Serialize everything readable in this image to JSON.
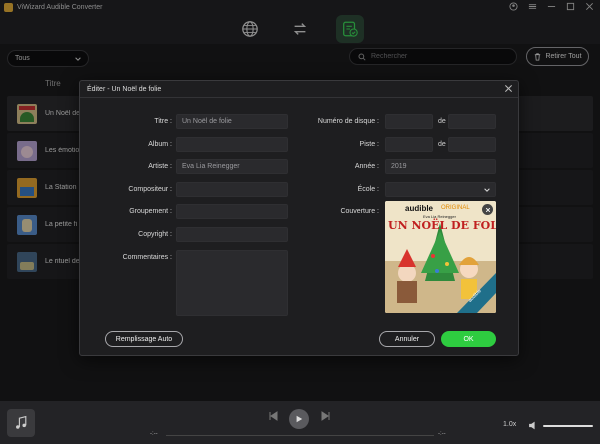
{
  "app": {
    "title": "ViWizard Audible Converter"
  },
  "toolbar": {
    "filter_selected": "Tous",
    "search_placeholder": "Rechercher",
    "remove_all_label": "Retirer Tout"
  },
  "list": {
    "column_title": "Titre",
    "items": [
      {
        "title": "Un Noël de folie"
      },
      {
        "title": "Les émotions"
      },
      {
        "title": "La Station"
      },
      {
        "title": "La petite fi"
      },
      {
        "title": "Le rituel de"
      }
    ]
  },
  "dialog": {
    "title": "Éditer - Un Noël de folie",
    "labels": {
      "title": "Titre :",
      "album": "Album :",
      "artist": "Artiste :",
      "composer": "Compositeur :",
      "grouping": "Groupement :",
      "copyright": "Copyright :",
      "comments": "Commentaires :",
      "disc": "Numéro de disque :",
      "track": "Piste :",
      "year": "Année :",
      "genre": "École :",
      "cover": "Couverture :",
      "of1": "de",
      "of2": "de"
    },
    "values": {
      "title": "Un Noël de folie",
      "album": "",
      "artist": "Eva Lia Reinegger",
      "composer": "",
      "grouping": "",
      "copyright": "",
      "comments": "",
      "disc_number": "",
      "disc_total": "",
      "track_number": "",
      "track_total": "",
      "year": "2019",
      "genre": ""
    },
    "cover": {
      "brand": "audible",
      "brand_suffix": "ORIGINAL",
      "author": "Eva Lia Reinegger",
      "headline": "UN NOËL DE FOLIE",
      "ribbon": "audible"
    },
    "buttons": {
      "autofill": "Remplissage Auto",
      "cancel": "Annuler",
      "ok": "OK"
    }
  },
  "player": {
    "time_left": "-:--",
    "time_right": "-:--",
    "speed": "1.0x"
  },
  "colors": {
    "accent": "#2ecc40",
    "background": "#1b1b1d"
  }
}
